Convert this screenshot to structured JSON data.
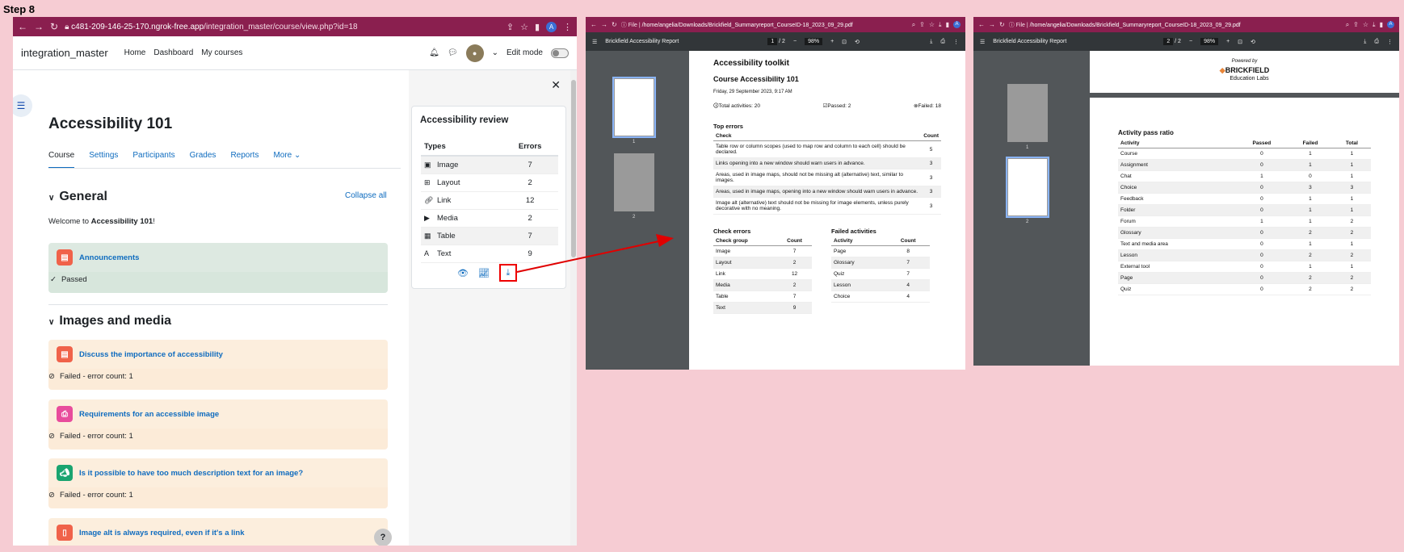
{
  "step_label": "Step 8",
  "browser1": {
    "url_prefix": "c481-209-146-25-170.ngrok-free.app",
    "url_path": "/integration_master/course/view.php?id=18",
    "site_name": "integration_master",
    "nav": [
      "Home",
      "Dashboard",
      "My courses"
    ],
    "edit_mode_label": "Edit mode",
    "course_title": "Accessibility 101",
    "tabs": [
      "Course",
      "Settings",
      "Participants",
      "Grades",
      "Reports",
      "More"
    ],
    "section_general": "General",
    "collapse_all": "Collapse all",
    "welcome_prefix": "Welcome to ",
    "welcome_bold": "Accessibility 101",
    "welcome_suffix": "!",
    "announcements": {
      "title": "Announcements",
      "status": "Passed"
    },
    "section_images": "Images and media",
    "activities": [
      {
        "title": "Discuss the importance of accessibility",
        "status": "Failed - error count: 1"
      },
      {
        "title": "Requirements for an accessible image",
        "status": "Failed - error count: 1"
      },
      {
        "title": "Is it possible to have too much description text for an image?",
        "status": "Failed - error count: 1"
      },
      {
        "title": "Image alt is always required, even if it's a link",
        "status": ""
      }
    ],
    "help": "?",
    "review": {
      "title": "Accessibility review",
      "col_types": "Types",
      "col_errors": "Errors",
      "rows": [
        {
          "type": "Image",
          "errors": "7"
        },
        {
          "type": "Layout",
          "errors": "2"
        },
        {
          "type": "Link",
          "errors": "12"
        },
        {
          "type": "Media",
          "errors": "2"
        },
        {
          "type": "Table",
          "errors": "7"
        },
        {
          "type": "Text",
          "errors": "9"
        }
      ]
    }
  },
  "browser2": {
    "url_prefix": "File",
    "url_path": "/home/angelia/Downloads/Brickfield_Summaryreport_CourseID-18_2023_09_29.pdf",
    "pdf_title": "Brickfield Accessibility Report",
    "page_indicator": "1",
    "page_total": "/ 2",
    "zoom": "98%",
    "thumb_labels": [
      "1",
      "2"
    ],
    "toolkit_title": "Accessibility toolkit",
    "course_title": "Course Accessibility 101",
    "date": "Friday, 29 September 2023, 9:17 AM",
    "total_activities": "Total activities: 20",
    "passed": "Passed: 2",
    "failed": "Failed: 18",
    "top_errors_title": "Top errors",
    "top_errors_cols": [
      "Check",
      "Count"
    ],
    "top_errors": [
      {
        "check": "Table row or column scopes (used to map row and column to each cell) should be declared.",
        "count": "5"
      },
      {
        "check": "Links opening into a new window should warn users in advance.",
        "count": "3"
      },
      {
        "check": "Areas, used in image maps, should not be missing alt (alternative) text, similar to images.",
        "count": "3"
      },
      {
        "check": "Areas, used in image maps, opening into a new window should warn users in advance.",
        "count": "3"
      },
      {
        "check": "Image alt (alternative) text should not be missing for image elements, unless purely decorative with no meaning.",
        "count": "3"
      }
    ],
    "check_errors_title": "Check errors",
    "check_errors_cols": [
      "Check group",
      "Count"
    ],
    "check_errors": [
      {
        "group": "Image",
        "count": "7"
      },
      {
        "group": "Layout",
        "count": "2"
      },
      {
        "group": "Link",
        "count": "12"
      },
      {
        "group": "Media",
        "count": "2"
      },
      {
        "group": "Table",
        "count": "7"
      },
      {
        "group": "Text",
        "count": "9"
      }
    ],
    "failed_title": "Failed activities",
    "failed_cols": [
      "Activity",
      "Count"
    ],
    "failed_activities": [
      {
        "activity": "Page",
        "count": "8"
      },
      {
        "activity": "Glossary",
        "count": "7"
      },
      {
        "activity": "Quiz",
        "count": "7"
      },
      {
        "activity": "Lesson",
        "count": "4"
      },
      {
        "activity": "Choice",
        "count": "4"
      }
    ]
  },
  "browser3": {
    "url_prefix": "File",
    "url_path": "/home/angelia/Downloads/Brickfield_Summaryreport_CourseID-18_2023_09_29.pdf",
    "pdf_title": "Brickfield Accessibility Report",
    "page_indicator": "2",
    "page_total": "/ 2",
    "zoom": "98%",
    "thumb_labels": [
      "1",
      "2"
    ],
    "powered_by": "Powered by",
    "logo_top": "BRICKFIELD",
    "logo_bottom": "Education Labs",
    "ratio_title": "Activity pass ratio",
    "ratio_cols": [
      "Activity",
      "Passed",
      "Failed",
      "Total"
    ],
    "ratio_rows": [
      [
        "Course",
        "0",
        "1",
        "1"
      ],
      [
        "Assignment",
        "0",
        "1",
        "1"
      ],
      [
        "Chat",
        "1",
        "0",
        "1"
      ],
      [
        "Choice",
        "0",
        "3",
        "3"
      ],
      [
        "Feedback",
        "0",
        "1",
        "1"
      ],
      [
        "Folder",
        "0",
        "1",
        "1"
      ],
      [
        "Forum",
        "1",
        "1",
        "2"
      ],
      [
        "Glossary",
        "0",
        "2",
        "2"
      ],
      [
        "Text and media area",
        "0",
        "1",
        "1"
      ],
      [
        "Lesson",
        "0",
        "2",
        "2"
      ],
      [
        "External tool",
        "0",
        "1",
        "1"
      ],
      [
        "Page",
        "0",
        "2",
        "2"
      ],
      [
        "Quiz",
        "0",
        "2",
        "2"
      ]
    ]
  },
  "colors": {
    "chrome": "#8a1f4f",
    "moodle_link": "#0f6cbf",
    "arrow": "#e00000"
  }
}
